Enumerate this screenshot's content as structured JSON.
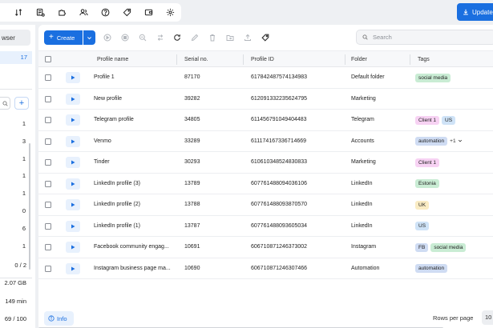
{
  "topbar": {
    "icons": [
      "sort-icon",
      "list-settings-icon",
      "puzzle-icon",
      "users-icon",
      "help-icon",
      "tag-shield-icon",
      "wallet-icon",
      "gear-icon"
    ],
    "update_label": "Update"
  },
  "sidebar": {
    "browser_label": "wser",
    "selected_count": "17",
    "folder_counts": [
      "1",
      "3",
      "1",
      "1",
      "1",
      "0",
      "6",
      "1"
    ],
    "stats": {
      "profiles": "0 / 2",
      "storage": "2.07 GB",
      "time": "149 min",
      "usage": "69 / 100"
    }
  },
  "toolbar": {
    "create_label": "Create",
    "search_placeholder": "Search"
  },
  "table": {
    "columns": [
      "Profile name",
      "Serial no.",
      "Profile ID",
      "Folder",
      "Tags"
    ],
    "rows": [
      {
        "name": "Profile 1",
        "serial": "87170",
        "id": "617842487574134983",
        "folder": "Default folder",
        "tags": [
          {
            "label": "social media",
            "color": "#c9ecd4"
          }
        ],
        "more": ""
      },
      {
        "name": "New profile",
        "serial": "39282",
        "id": "612091332235624795",
        "folder": "Marketing",
        "tags": [],
        "more": ""
      },
      {
        "name": "Telegram profile",
        "serial": "34805",
        "id": "611456791049404483",
        "folder": "Telegram",
        "tags": [
          {
            "label": "Client 1",
            "color": "#f7d2f3"
          },
          {
            "label": "US",
            "color": "#cfe3f7"
          }
        ],
        "more": ""
      },
      {
        "name": "Venmo",
        "serial": "33289",
        "id": "611174167336714669",
        "folder": "Accounts",
        "tags": [
          {
            "label": "automation",
            "color": "#cfdcf3"
          }
        ],
        "more": "+1"
      },
      {
        "name": "Tinder",
        "serial": "30293",
        "id": "610610348524830833",
        "folder": "Marketing",
        "tags": [
          {
            "label": "Client 1",
            "color": "#f7d2f3"
          }
        ],
        "more": ""
      },
      {
        "name": "LinkedIn profile (3)",
        "serial": "13789",
        "id": "607761488094036106",
        "folder": "LinkedIn",
        "tags": [
          {
            "label": "Estonia",
            "color": "#c9ecd4"
          }
        ],
        "more": ""
      },
      {
        "name": "LinkedIn profile (2)",
        "serial": "13788",
        "id": "607761488093870570",
        "folder": "LinkedIn",
        "tags": [
          {
            "label": "UK",
            "color": "#faecc4"
          }
        ],
        "more": ""
      },
      {
        "name": "LinkedIn profile (1)",
        "serial": "13787",
        "id": "607761488093605034",
        "folder": "LinkedIn",
        "tags": [
          {
            "label": "US",
            "color": "#cfe3f7"
          }
        ],
        "more": ""
      },
      {
        "name": "Facebook community engag...",
        "serial": "10691",
        "id": "606710871246373002",
        "folder": "Instagram",
        "tags": [
          {
            "label": "FB",
            "color": "#cfdcf3"
          },
          {
            "label": "social media",
            "color": "#c9ecd4"
          }
        ],
        "more": ""
      },
      {
        "name": "Instagram business page ma...",
        "serial": "10690",
        "id": "606710871246307466",
        "folder": "Automation",
        "tags": [
          {
            "label": "automation",
            "color": "#cfdcf3"
          }
        ],
        "more": ""
      }
    ]
  },
  "footer": {
    "info_label": "Info",
    "rows_per_page_label": "Rows per page",
    "rows_per_page_value": "10"
  },
  "colors": {
    "accent": "#1a6fe0"
  }
}
